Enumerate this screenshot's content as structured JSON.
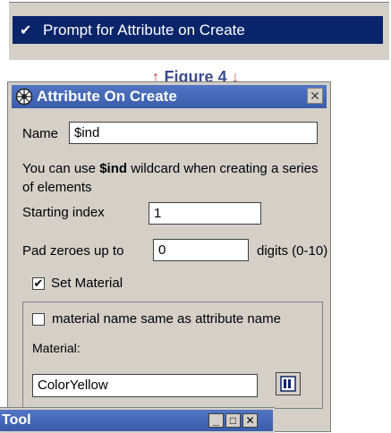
{
  "menu": {
    "item_label": "Prompt for Attribute on Create",
    "checked": true
  },
  "caption": {
    "up_arrow": "↑",
    "text": "Figure 4",
    "down_arrow": "↓"
  },
  "dialog": {
    "title": "Attribute On Create",
    "close_glyph": "✕",
    "name_label": "Name",
    "name_value": "$ind",
    "info_prefix": "You can use ",
    "info_keyword": "$ind",
    "info_suffix": " wildcard when creating a series of elements",
    "starting_index_label": "Starting index",
    "starting_index_value": "1",
    "pad_label": "Pad zeroes up to",
    "pad_value": "0",
    "pad_suffix": "digits (0-10)",
    "set_material_label": "Set Material",
    "set_material_checked": true,
    "same_name_label": "material name same as attribute name",
    "same_name_checked": false,
    "material_label": "Material:",
    "material_value": "ColorYellow"
  },
  "tool_window": {
    "title": "Tool",
    "min_glyph": "_",
    "max_glyph": "□",
    "close_glyph": "✕"
  },
  "colors": {
    "selection": "#0a246a",
    "titlebar": "#3a5caa",
    "dialog_bg": "#d4d0c8",
    "caption": "#3a4b8c",
    "arrow": "#c0504d"
  }
}
